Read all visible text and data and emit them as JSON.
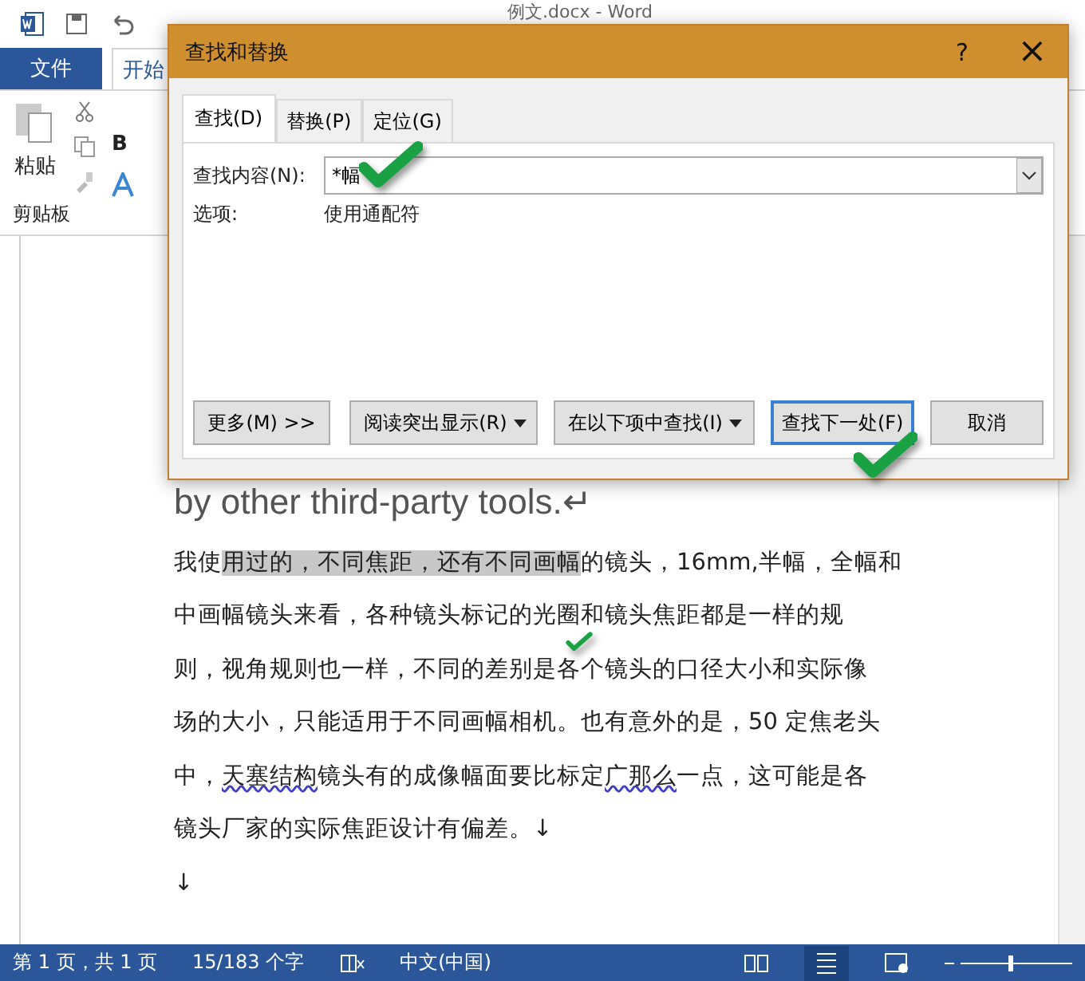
{
  "word": {
    "title": "例文.docx - Word",
    "tabs": [
      {
        "label": "文件",
        "selected": false,
        "kind": "file"
      },
      {
        "label": "开始",
        "selected": true,
        "kind": "tab"
      }
    ],
    "ribbon": {
      "paste": "粘贴",
      "group": "剪贴板",
      "bold": "B"
    }
  },
  "dialog": {
    "title": "查找和替换",
    "help": "?",
    "close": "×",
    "tabs": [
      {
        "label": "查找(D)",
        "selected": true
      },
      {
        "label": "替换(P)",
        "selected": false
      },
      {
        "label": "定位(G)",
        "selected": false
      }
    ],
    "find": {
      "label": "查找内容(N):",
      "value": "*幅"
    },
    "options": {
      "label": "选项:",
      "value": "使用通配符"
    },
    "buttons": [
      {
        "label": "更多(M) >>",
        "dropdown": false,
        "default": false
      },
      {
        "label": "阅读突出显示(R)",
        "dropdown": true,
        "default": false
      },
      {
        "label": "在以下项中查找(I)",
        "dropdown": true,
        "default": false
      },
      {
        "label": "查找下一处(F)",
        "dropdown": false,
        "default": true
      },
      {
        "label": "取消",
        "dropdown": false,
        "default": false
      }
    ]
  },
  "document": {
    "heading": "by other third-party tools.↵",
    "lines": [
      [
        {
          "text": "我使"
        },
        {
          "text": "用过的，不同焦距，还有不同画幅",
          "highlighted": true
        },
        {
          "text": "的镜头，16mm,半幅，全幅和"
        }
      ],
      [
        {
          "text": "中画幅镜头来看，各种镜头标记的光圈和镜头焦距都是一样的规"
        }
      ],
      [
        {
          "text": "则，视角规则也一样，不同的差别是各个镜头的口径大小和实际像"
        }
      ],
      [
        {
          "text": "场的大小，只能适用于不同画幅相机。也有意外的是，50 定焦老头"
        }
      ],
      [
        {
          "text": "中，"
        },
        {
          "text": "天塞结构",
          "misspelled": true
        },
        {
          "text": "镜头有的成像幅面要比标定"
        },
        {
          "text": "广那么",
          "misspelled": true
        },
        {
          "text": "一点，这可能是各"
        }
      ],
      [
        {
          "text": "镜头厂家的实际焦距设计有偏差。↓"
        }
      ],
      [
        {
          "text": "↓"
        }
      ]
    ]
  },
  "status_bar": {
    "page": "第 1 页，共 1 页",
    "words": "15/183 个字",
    "language": "中文(中国)"
  }
}
